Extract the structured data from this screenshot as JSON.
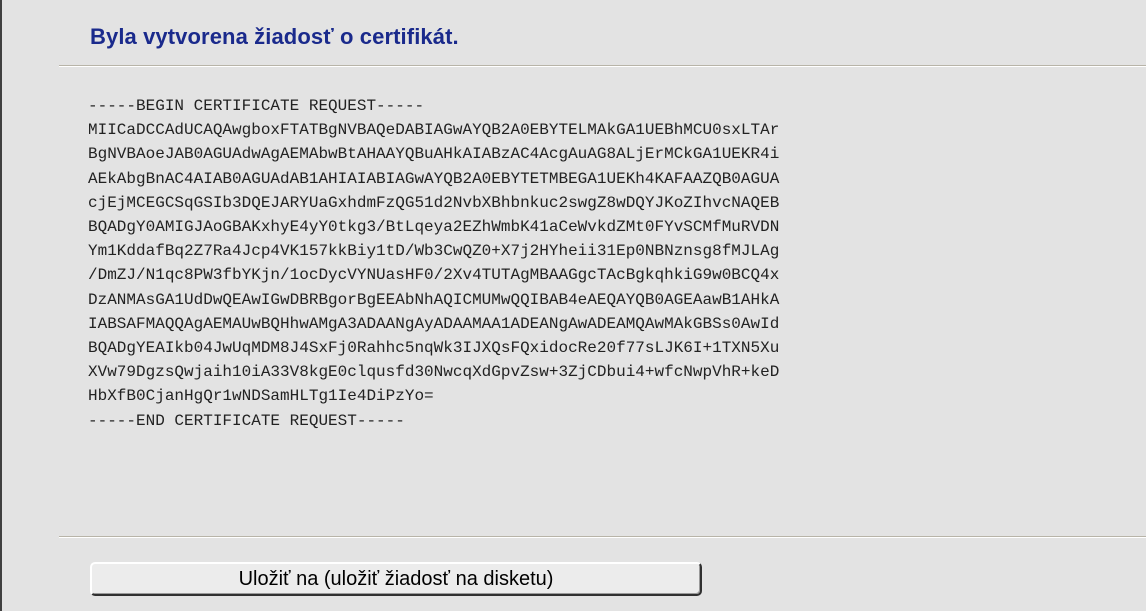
{
  "page": {
    "title": "Byla vytvorena žiadosť o certifikát."
  },
  "certificate_request": {
    "lines": [
      "-----BEGIN CERTIFICATE REQUEST-----",
      "MIICaDCCAdUCAQAwgboxFTATBgNVBAQeDABIAGwAYQB2A0EBYTELMAkGA1UEBhMCU0sxLTAr",
      "BgNVBAoeJAB0AGUAdwAgAEMAbwBtAHAAYQBuAHkAIABzAC4AcgAuAG8ALjErMCkGA1UEKR4i",
      "AEkAbgBnAC4AIAB0AGUAdAB1AHIAIABIAGwAYQB2A0EBYTETMBEGA1UEKh4KAFAAZQB0AGUA",
      "cjEjMCEGCSqGSIb3DQEJARYUaGxhdmFzQG51d2NvbXBhbnkuc2swgZ8wDQYJKoZIhvcNAQEB",
      "BQADgY0AMIGJAoGBAKxhyE4yY0tkg3/BtLqeya2EZhWmbK41aCeWvkdZMt0FYvSCMfMuRVDN",
      "Ym1KddafBq2Z7Ra4Jcp4VK157kkBiy1tD/Wb3CwQZ0+X7j2HYheii31Ep0NBNznsg8fMJLAg",
      "/DmZJ/N1qc8PW3fbYKjn/1ocDycVYNUasHF0/2Xv4TUTAgMBAAGgcTAcBgkqhkiG9w0BCQ4x",
      "DzANMAsGA1UdDwQEAwIGwDBRBgorBgEEAbNhAQICMUMwQQIBAB4eAEQAYQB0AGEAawB1AHkA",
      "IABSAFMAQQAgAEMAUwBQHhwAMgA3ADAANgAyADAAMAA1ADEANgAwADEAMQAwMAkGBSs0AwId",
      "BQADgYEAIkb04JwUqMDM8J4SxFj0Rahhc5nqWk3IJXQsFQxidocRe20f77sLJK6I+1TXN5Xu",
      "XVw79DgzsQwjaih10iA33V8kgE0clqusfd30NwcqXdGpvZsw+3ZjCDbui4+wfcNwpVhR+keD",
      "HbXfB0CjanHgQr1wNDSamHLTg1Ie4DiPzYo=",
      "-----END CERTIFICATE REQUEST-----"
    ]
  },
  "actions": {
    "save_label": "Uložiť na (uložiť žiadosť na disketu)"
  }
}
